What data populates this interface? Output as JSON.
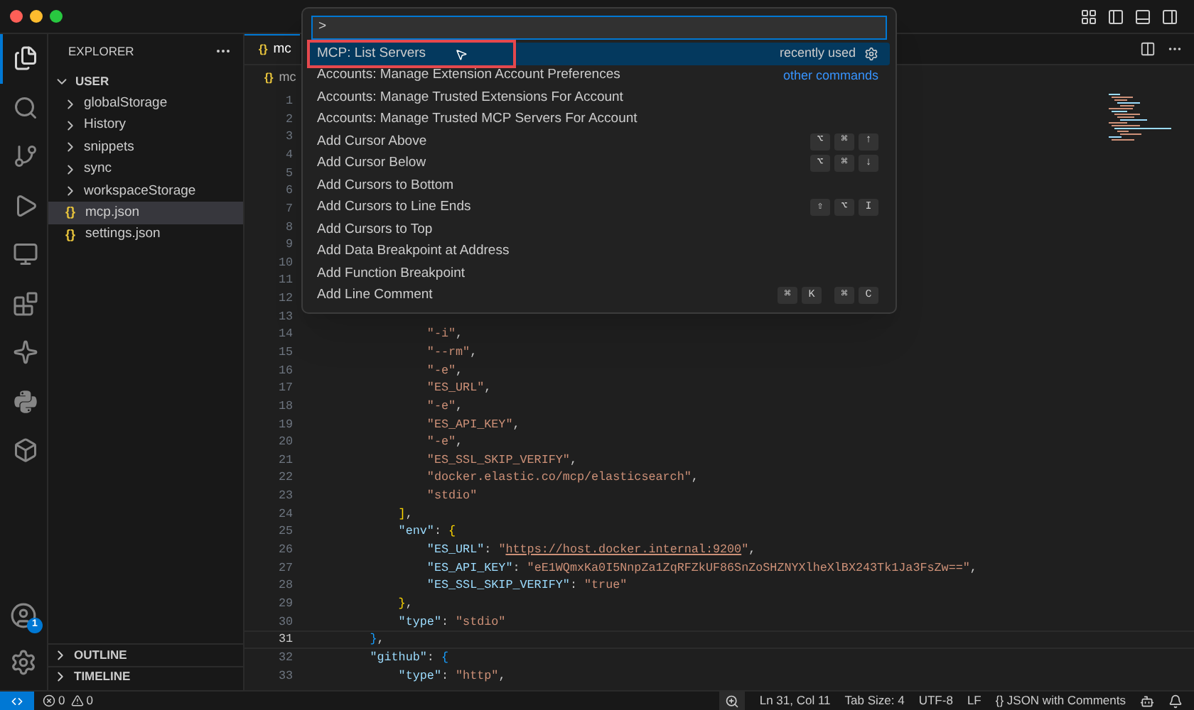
{
  "activity_bar": {
    "top": [
      {
        "kind": "files",
        "selected": true
      },
      {
        "kind": "search",
        "selected": false
      },
      {
        "kind": "source-control",
        "selected": false
      },
      {
        "kind": "run-debug",
        "selected": false
      },
      {
        "kind": "remote",
        "selected": false
      },
      {
        "kind": "extensions",
        "selected": false
      },
      {
        "kind": "sparkle",
        "selected": false
      },
      {
        "kind": "python",
        "selected": false
      },
      {
        "kind": "containers",
        "selected": false
      }
    ],
    "bottom": [
      {
        "kind": "account",
        "badge": "1"
      },
      {
        "kind": "settings"
      }
    ]
  },
  "sidebar": {
    "title": "EXPLORER",
    "tree": [
      {
        "label": "USER",
        "kind": "root",
        "expanded": true,
        "selected": false,
        "children": [
          {
            "label": "globalStorage",
            "kind": "folder",
            "expanded": false,
            "selected": false
          },
          {
            "label": "History",
            "kind": "folder",
            "expanded": false,
            "selected": false
          },
          {
            "label": "snippets",
            "kind": "folder",
            "expanded": false,
            "selected": false
          },
          {
            "label": "sync",
            "kind": "folder",
            "expanded": false,
            "selected": false
          },
          {
            "label": "workspaceStorage",
            "kind": "folder",
            "expanded": false,
            "selected": false
          },
          {
            "label": "mcp.json",
            "kind": "file",
            "icon": "{}",
            "selected": true
          },
          {
            "label": "settings.json",
            "kind": "file",
            "icon": "{}",
            "selected": false
          }
        ]
      }
    ],
    "sections": [
      {
        "label": "OUTLINE",
        "expanded": false
      },
      {
        "label": "TIMELINE",
        "expanded": false
      }
    ]
  },
  "editor": {
    "tab": {
      "icon": "{}",
      "label": "mc"
    },
    "breadcrumb": {
      "icon": "{}",
      "label": "mc"
    },
    "lines": [
      {
        "number": "1",
        "current": false
      },
      {
        "number": "2",
        "current": false
      },
      {
        "number": "3",
        "current": false
      },
      {
        "number": "4",
        "current": false
      },
      {
        "number": "5",
        "current": false
      },
      {
        "number": "6",
        "current": false
      },
      {
        "number": "7",
        "current": false
      },
      {
        "number": "8",
        "current": false
      },
      {
        "number": "9",
        "current": false
      },
      {
        "number": "10",
        "current": false
      },
      {
        "number": "11",
        "current": false
      },
      {
        "number": "12",
        "current": false
      },
      {
        "number": "13",
        "current": false
      },
      {
        "number": "14",
        "current": false,
        "tokens": [
          {
            "t": "                \"-i\"",
            "kind": "string"
          },
          {
            "t": ",",
            "kind": "punct"
          }
        ]
      },
      {
        "number": "15",
        "current": false,
        "tokens": [
          {
            "t": "                \"--rm\"",
            "kind": "string"
          },
          {
            "t": ",",
            "kind": "punct"
          }
        ]
      },
      {
        "number": "16",
        "current": false,
        "tokens": [
          {
            "t": "                \"-e\"",
            "kind": "string"
          },
          {
            "t": ",",
            "kind": "punct"
          }
        ]
      },
      {
        "number": "17",
        "current": false,
        "tokens": [
          {
            "t": "                \"ES_URL\"",
            "kind": "string"
          },
          {
            "t": ",",
            "kind": "punct"
          }
        ]
      },
      {
        "number": "18",
        "current": false,
        "tokens": [
          {
            "t": "                \"-e\"",
            "kind": "string"
          },
          {
            "t": ",",
            "kind": "punct"
          }
        ]
      },
      {
        "number": "19",
        "current": false,
        "tokens": [
          {
            "t": "                \"ES_API_KEY\"",
            "kind": "string"
          },
          {
            "t": ",",
            "kind": "punct"
          }
        ]
      },
      {
        "number": "20",
        "current": false,
        "tokens": [
          {
            "t": "                \"-e\"",
            "kind": "string"
          },
          {
            "t": ",",
            "kind": "punct"
          }
        ]
      },
      {
        "number": "21",
        "current": false,
        "tokens": [
          {
            "t": "                \"ES_SSL_SKIP_VERIFY\"",
            "kind": "string"
          },
          {
            "t": ",",
            "kind": "punct"
          }
        ]
      },
      {
        "number": "22",
        "current": false,
        "tokens": [
          {
            "t": "                \"docker.elastic.co/mcp/elasticsearch\"",
            "kind": "string"
          },
          {
            "t": ",",
            "kind": "punct"
          }
        ]
      },
      {
        "number": "23",
        "current": false,
        "tokens": [
          {
            "t": "                \"stdio\"",
            "kind": "string"
          }
        ]
      },
      {
        "number": "24",
        "current": false,
        "tokens": [
          {
            "t": "            ]",
            "kind": "bracket"
          },
          {
            "t": ",",
            "kind": "punct"
          }
        ]
      },
      {
        "number": "25",
        "current": false,
        "tokens": [
          {
            "t": "            \"env\"",
            "kind": "key"
          },
          {
            "t": ": ",
            "kind": "punct"
          },
          {
            "t": "{",
            "kind": "bracket"
          }
        ]
      },
      {
        "number": "26",
        "current": false,
        "tokens": [
          {
            "t": "                \"ES_URL\"",
            "kind": "key"
          },
          {
            "t": ": ",
            "kind": "punct"
          },
          {
            "t": "\"",
            "kind": "string"
          },
          {
            "t": "https://host.docker.internal:9200",
            "kind": "link"
          },
          {
            "t": "\"",
            "kind": "string"
          },
          {
            "t": ",",
            "kind": "punct"
          }
        ]
      },
      {
        "number": "27",
        "current": false,
        "tokens": [
          {
            "t": "                \"ES_API_KEY\"",
            "kind": "key"
          },
          {
            "t": ": ",
            "kind": "punct"
          },
          {
            "t": "\"eE1WQmxKa0I5NnpZa1ZqRFZkUF86SnZoSHZNYXlheXlBX243Tk1Ja3FsZw==\"",
            "kind": "string"
          },
          {
            "t": ",",
            "kind": "punct"
          }
        ]
      },
      {
        "number": "28",
        "current": false,
        "tokens": [
          {
            "t": "                \"ES_SSL_SKIP_VERIFY\"",
            "kind": "key"
          },
          {
            "t": ": ",
            "kind": "punct"
          },
          {
            "t": "\"true\"",
            "kind": "string"
          }
        ]
      },
      {
        "number": "29",
        "current": false,
        "tokens": [
          {
            "t": "            }",
            "kind": "bracket"
          },
          {
            "t": ",",
            "kind": "punct"
          }
        ]
      },
      {
        "number": "30",
        "current": false,
        "tokens": [
          {
            "t": "            \"type\"",
            "kind": "key"
          },
          {
            "t": ": ",
            "kind": "punct"
          },
          {
            "t": "\"stdio\"",
            "kind": "string"
          }
        ]
      },
      {
        "number": "31",
        "current": true,
        "tokens": [
          {
            "t": "        }",
            "kind": "brace2"
          },
          {
            "t": ",",
            "kind": "punct"
          }
        ]
      },
      {
        "number": "32",
        "current": false,
        "tokens": [
          {
            "t": "        \"github\"",
            "kind": "key"
          },
          {
            "t": ": ",
            "kind": "punct"
          },
          {
            "t": "{",
            "kind": "brace2"
          }
        ]
      },
      {
        "number": "33",
        "current": false,
        "tokens": [
          {
            "t": "            \"type\"",
            "kind": "key"
          },
          {
            "t": ": ",
            "kind": "punct"
          },
          {
            "t": "\"http\"",
            "kind": "string"
          },
          {
            "t": ",",
            "kind": "punct"
          }
        ]
      }
    ]
  },
  "command_palette": {
    "value": ">",
    "items": [
      {
        "label": "MCP: List Servers",
        "selected": true,
        "outlined": true,
        "detail": {
          "text": "recently used",
          "kind": "recent"
        }
      },
      {
        "label": "Accounts: Manage Extension Account Preferences",
        "selected": false,
        "outlined": false,
        "detail": {
          "text": "other commands",
          "kind": "link"
        }
      },
      {
        "label": "Accounts: Manage Trusted Extensions For Account",
        "selected": false,
        "outlined": false
      },
      {
        "label": "Accounts: Manage Trusted MCP Servers For Account",
        "selected": false,
        "outlined": false
      },
      {
        "label": "Add Cursor Above",
        "selected": false,
        "outlined": false,
        "keys": [
          [
            "⌥",
            "⌘",
            "↑"
          ]
        ]
      },
      {
        "label": "Add Cursor Below",
        "selected": false,
        "outlined": false,
        "keys": [
          [
            "⌥",
            "⌘",
            "↓"
          ]
        ]
      },
      {
        "label": "Add Cursors to Bottom",
        "selected": false,
        "outlined": false
      },
      {
        "label": "Add Cursors to Line Ends",
        "selected": false,
        "outlined": false,
        "keys": [
          [
            "⇧",
            "⌥",
            "I"
          ]
        ]
      },
      {
        "label": "Add Cursors to Top",
        "selected": false,
        "outlined": false
      },
      {
        "label": "Add Data Breakpoint at Address",
        "selected": false,
        "outlined": false
      },
      {
        "label": "Add Function Breakpoint",
        "selected": false,
        "outlined": false
      },
      {
        "label": "Add Line Comment",
        "selected": false,
        "outlined": false,
        "keys": [
          [
            "⌘",
            "K"
          ],
          [
            "⌘",
            "C"
          ]
        ]
      }
    ]
  },
  "status_bar": {
    "problems": [
      {
        "kind": "errors",
        "count": "0"
      },
      {
        "kind": "warnings",
        "count": "0"
      }
    ],
    "right": [
      {
        "kind": "zoom"
      },
      {
        "kind": "text",
        "text": "Ln 31, Col 11"
      },
      {
        "kind": "text",
        "text": "Tab Size: 4"
      },
      {
        "kind": "text",
        "text": "UTF-8"
      },
      {
        "kind": "text",
        "text": "LF"
      },
      {
        "kind": "text",
        "text": "{} JSON with Comments"
      },
      {
        "kind": "copilot"
      },
      {
        "kind": "bell"
      }
    ]
  }
}
